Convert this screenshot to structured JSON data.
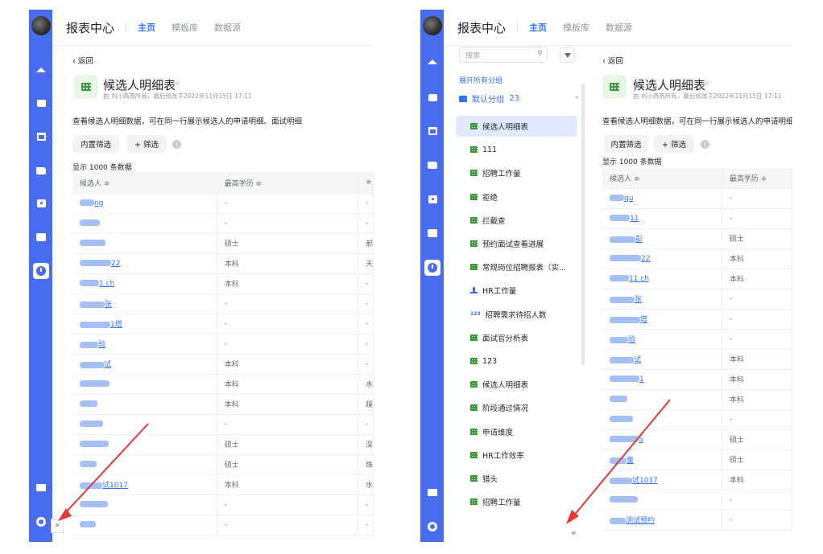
{
  "app": {
    "title": "报表中心",
    "tabs": [
      "主页",
      "模板库",
      "数据源"
    ]
  },
  "sidebar": {
    "search_placeholder": "搜索",
    "expand_all": "展开所有分组",
    "group": {
      "name": "默认分组",
      "count": "23"
    },
    "items": [
      "候选人明细表",
      "111",
      "招聘工作量",
      "拒绝",
      "拦截查",
      "预约面试查看进展",
      "常规岗位招聘报表（实...",
      "HR工作量",
      "招聘需求待招人数",
      "面试官分析表",
      "123",
      "候选人明细表",
      "阶段通过情况",
      "申请维度",
      "HR工作效率",
      "猎头",
      "招聘工作量"
    ],
    "collapse_label": "«"
  },
  "report": {
    "back_label": "返回",
    "title": "候选人明细表",
    "meta": "由 刘小燕燕所有，最后修改于2022年11月15日 17:11",
    "desc_left": "查看候选人明细数据，可在同一行展示候选人的申请明细、面试明细",
    "desc_right": "查看候选人明细数据，可在同一行展示候选人的申请明细、",
    "btn_inner_filter": "内置筛选",
    "btn_add_filter": "+ 筛选",
    "count": "显示 1000 条数据",
    "col_candidate": "候选人 ≑",
    "col_edu": "最高学历 ≑",
    "col_third": "≑",
    "left_rows": [
      {
        "n": "ng",
        "e": "-",
        "t": "-"
      },
      {
        "n": "",
        "e": "-",
        "t": "-"
      },
      {
        "n": "",
        "e": "硕士",
        "t": "郝"
      },
      {
        "n": "22",
        "e": "本科",
        "t": "天"
      },
      {
        "n": "1 ch",
        "e": "本科",
        "t": "-"
      },
      {
        "n": "张",
        "e": "-",
        "t": "-"
      },
      {
        "n": "1塔",
        "e": "-",
        "t": "-"
      },
      {
        "n": "验",
        "e": "-",
        "t": "-"
      },
      {
        "n": "试",
        "e": "本科",
        "t": "-"
      },
      {
        "n": "",
        "e": "本科",
        "t": "水"
      },
      {
        "n": "",
        "e": "本科",
        "t": "蹊"
      },
      {
        "n": "",
        "e": "-",
        "t": "-"
      },
      {
        "n": "",
        "e": "硕士",
        "t": "深"
      },
      {
        "n": "",
        "e": "硕士",
        "t": "珠"
      },
      {
        "n": "试1017",
        "e": "本科",
        "t": "水"
      },
      {
        "n": "",
        "e": "-",
        "t": "-"
      },
      {
        "n": "",
        "e": "-",
        "t": "-"
      }
    ],
    "right_rows": [
      {
        "n": "qu",
        "e": "-"
      },
      {
        "n": "11",
        "e": "-"
      },
      {
        "n": "彭",
        "e": "硕士"
      },
      {
        "n": "22",
        "e": "本科"
      },
      {
        "n": "11 ch",
        "e": "本科"
      },
      {
        "n": "张",
        "e": "-"
      },
      {
        "n": "塔",
        "e": "-"
      },
      {
        "n": "验",
        "e": "-"
      },
      {
        "n": "试",
        "e": "本科"
      },
      {
        "n": "1",
        "e": "本科"
      },
      {
        "n": "",
        "e": "本科"
      },
      {
        "n": "",
        "e": "-"
      },
      {
        "n": "S",
        "e": "硕士"
      },
      {
        "n": "董",
        "e": "硕士"
      },
      {
        "n": "试1017",
        "e": "本科"
      },
      {
        "n": "",
        "e": "-"
      },
      {
        "n": "测试预约",
        "e": "-"
      }
    ]
  },
  "expand_label": "»"
}
